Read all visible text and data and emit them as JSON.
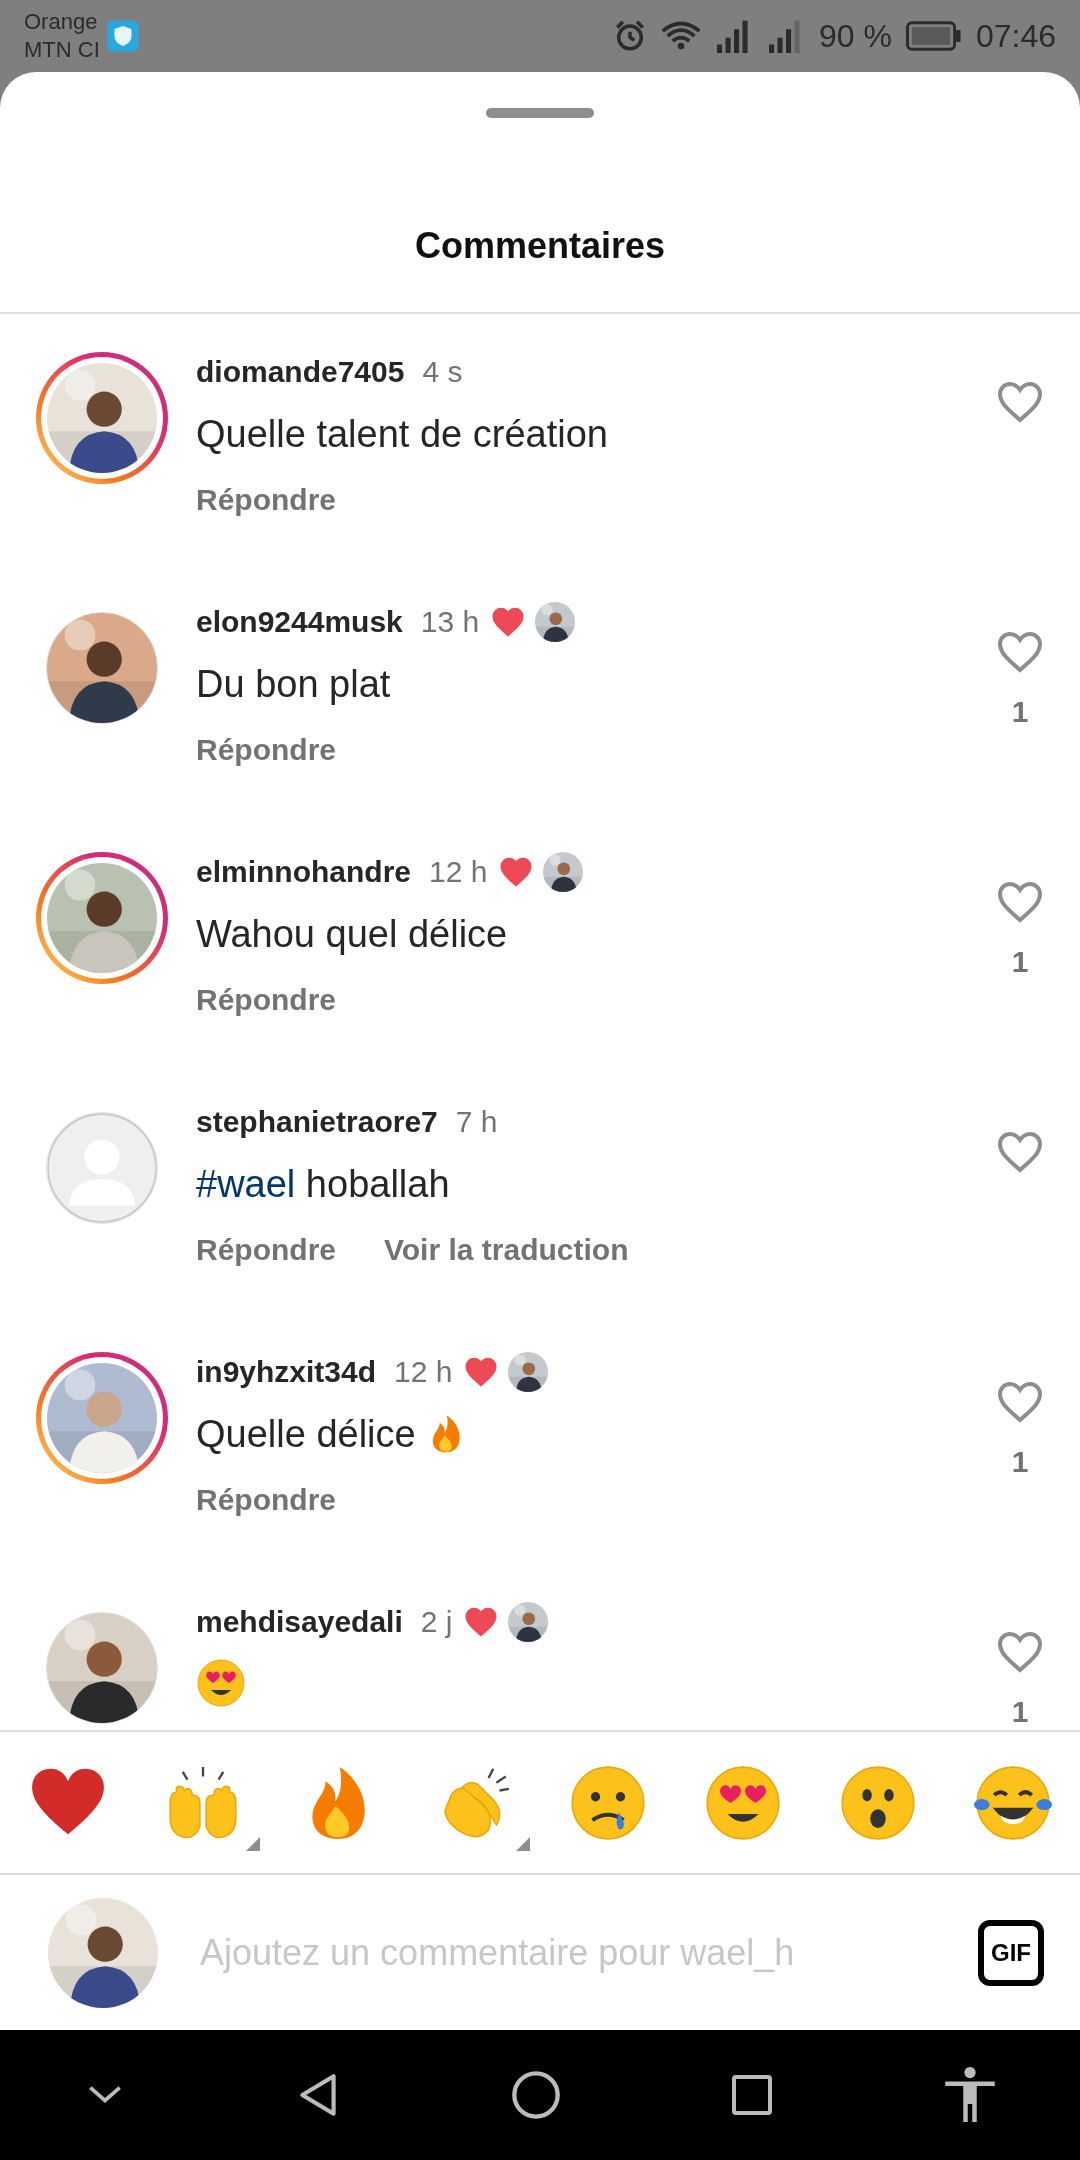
{
  "status_bar": {
    "carrier_lines": [
      "Orange",
      "MTN CI"
    ],
    "battery_text": "90 %",
    "time": "07:46"
  },
  "sheet": {
    "title": "Commentaires"
  },
  "comments": [
    {
      "username": "diomande7405",
      "time": "4 s",
      "story": true,
      "avatar": {
        "kind": "picture"
      },
      "creator_liked": false,
      "text": "Quelle talent de création",
      "actions": [
        "Répondre"
      ]
    },
    {
      "username": "elon9244musk",
      "time": "13 h",
      "story": false,
      "avatar": {
        "kind": "picture"
      },
      "creator_liked": true,
      "text": "Du bon plat",
      "likes": "1",
      "actions": [
        "Répondre"
      ]
    },
    {
      "username": "elminnohandre",
      "time": "12 h",
      "story": true,
      "avatar": {
        "kind": "picture"
      },
      "creator_liked": true,
      "text": "Wahou quel délice",
      "likes": "1",
      "actions": [
        "Répondre"
      ]
    },
    {
      "username": "stephanietraore7",
      "time": "7 h",
      "story": false,
      "avatar": {
        "kind": "default"
      },
      "creator_liked": false,
      "hashtag": "#wael",
      "text": "hoballah",
      "actions": [
        "Répondre",
        "Voir la traduction"
      ]
    },
    {
      "username": "in9yhzxit34d",
      "time": "12 h",
      "story": true,
      "avatar": {
        "kind": "picture"
      },
      "creator_liked": true,
      "text": "Quelle délice",
      "trailing_emoji": {
        "kind": "fire"
      },
      "likes": "1",
      "actions": [
        "Répondre"
      ]
    },
    {
      "username": "mehdisayedali",
      "time": "2 j",
      "story": false,
      "avatar": {
        "kind": "picture"
      },
      "creator_liked": true,
      "trailing_emoji": {
        "kind": "heart-eyes"
      },
      "likes": "1"
    }
  ],
  "reactions": [
    {
      "kind": "heart",
      "has_variants": false
    },
    {
      "kind": "raising-hands",
      "has_variants": true
    },
    {
      "kind": "fire",
      "has_variants": false
    },
    {
      "kind": "clapping",
      "has_variants": true
    },
    {
      "kind": "crying",
      "has_variants": false
    },
    {
      "kind": "heart-eyes",
      "has_variants": false
    },
    {
      "kind": "surprised",
      "has_variants": false
    },
    {
      "kind": "tears-of-joy",
      "has_variants": false
    }
  ],
  "composer": {
    "placeholder": "Ajoutez un commentaire pour wael_h",
    "gif_label": "GIF"
  }
}
